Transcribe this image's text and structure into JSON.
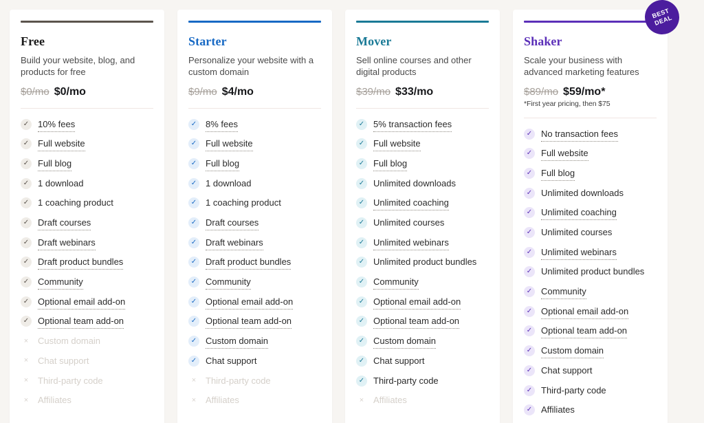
{
  "badge": {
    "line1": "BEST",
    "line2": "DEAL"
  },
  "plans": [
    {
      "id": "free",
      "name": "Free",
      "description": "Build your website, blog, and products for free",
      "price_old": "$0/mo",
      "price_now": "$0/mo",
      "price_note": "",
      "accent": "#5b544d",
      "features": [
        {
          "label": "10% fees",
          "included": true,
          "tooltip": true
        },
        {
          "label": "Full website",
          "included": true,
          "tooltip": true
        },
        {
          "label": "Full blog",
          "included": true,
          "tooltip": true
        },
        {
          "label": "1 download",
          "included": true,
          "tooltip": false
        },
        {
          "label": "1 coaching product",
          "included": true,
          "tooltip": false
        },
        {
          "label": "Draft courses",
          "included": true,
          "tooltip": true
        },
        {
          "label": "Draft webinars",
          "included": true,
          "tooltip": true
        },
        {
          "label": "Draft product bundles",
          "included": true,
          "tooltip": true
        },
        {
          "label": "Community",
          "included": true,
          "tooltip": true
        },
        {
          "label": "Optional email add-on",
          "included": true,
          "tooltip": true
        },
        {
          "label": "Optional team add-on",
          "included": true,
          "tooltip": true
        },
        {
          "label": "Custom domain",
          "included": false,
          "tooltip": false
        },
        {
          "label": "Chat support",
          "included": false,
          "tooltip": false
        },
        {
          "label": "Third-party code",
          "included": false,
          "tooltip": false
        },
        {
          "label": "Affiliates",
          "included": false,
          "tooltip": false
        }
      ]
    },
    {
      "id": "starter",
      "name": "Starter",
      "description": "Personalize your website with a custom domain",
      "price_old": "$9/mo",
      "price_now": "$4/mo",
      "price_note": "",
      "accent": "#1769c4",
      "features": [
        {
          "label": "8% fees",
          "included": true,
          "tooltip": true
        },
        {
          "label": "Full website",
          "included": true,
          "tooltip": true
        },
        {
          "label": "Full blog",
          "included": true,
          "tooltip": true
        },
        {
          "label": "1 download",
          "included": true,
          "tooltip": false
        },
        {
          "label": "1 coaching product",
          "included": true,
          "tooltip": false
        },
        {
          "label": "Draft courses",
          "included": true,
          "tooltip": true
        },
        {
          "label": "Draft webinars",
          "included": true,
          "tooltip": true
        },
        {
          "label": "Draft product bundles",
          "included": true,
          "tooltip": true
        },
        {
          "label": "Community",
          "included": true,
          "tooltip": true
        },
        {
          "label": "Optional email add-on",
          "included": true,
          "tooltip": true
        },
        {
          "label": "Optional team add-on",
          "included": true,
          "tooltip": true
        },
        {
          "label": "Custom domain",
          "included": true,
          "tooltip": true
        },
        {
          "label": "Chat support",
          "included": true,
          "tooltip": false
        },
        {
          "label": "Third-party code",
          "included": false,
          "tooltip": false
        },
        {
          "label": "Affiliates",
          "included": false,
          "tooltip": false
        }
      ]
    },
    {
      "id": "mover",
      "name": "Mover",
      "description": "Sell online courses and other digital products",
      "price_old": "$39/mo",
      "price_now": "$33/mo",
      "price_note": "",
      "accent": "#1a7a96",
      "features": [
        {
          "label": "5% transaction fees",
          "included": true,
          "tooltip": true
        },
        {
          "label": "Full website",
          "included": true,
          "tooltip": true
        },
        {
          "label": "Full blog",
          "included": true,
          "tooltip": true
        },
        {
          "label": "Unlimited downloads",
          "included": true,
          "tooltip": false
        },
        {
          "label": "Unlimited coaching",
          "included": true,
          "tooltip": true
        },
        {
          "label": "Unlimited courses",
          "included": true,
          "tooltip": false
        },
        {
          "label": "Unlimited webinars",
          "included": true,
          "tooltip": true
        },
        {
          "label": "Unlimited product bundles",
          "included": true,
          "tooltip": false
        },
        {
          "label": "Community",
          "included": true,
          "tooltip": true
        },
        {
          "label": "Optional email add-on",
          "included": true,
          "tooltip": true
        },
        {
          "label": "Optional team add-on",
          "included": true,
          "tooltip": true
        },
        {
          "label": "Custom domain",
          "included": true,
          "tooltip": true
        },
        {
          "label": "Chat support",
          "included": true,
          "tooltip": false
        },
        {
          "label": "Third-party code",
          "included": true,
          "tooltip": false
        },
        {
          "label": "Affiliates",
          "included": false,
          "tooltip": false
        }
      ]
    },
    {
      "id": "shaker",
      "name": "Shaker",
      "description": "Scale your business with advanced marketing features",
      "price_old": "$89/mo",
      "price_now": "$59/mo*",
      "price_note": "*First year pricing, then $75",
      "accent": "#5b2fb8",
      "features": [
        {
          "label": "No transaction fees",
          "included": true,
          "tooltip": true
        },
        {
          "label": "Full website",
          "included": true,
          "tooltip": true
        },
        {
          "label": "Full blog",
          "included": true,
          "tooltip": true
        },
        {
          "label": "Unlimited downloads",
          "included": true,
          "tooltip": false
        },
        {
          "label": "Unlimited coaching",
          "included": true,
          "tooltip": true
        },
        {
          "label": "Unlimited courses",
          "included": true,
          "tooltip": false
        },
        {
          "label": "Unlimited webinars",
          "included": true,
          "tooltip": true
        },
        {
          "label": "Unlimited product bundles",
          "included": true,
          "tooltip": false
        },
        {
          "label": "Community",
          "included": true,
          "tooltip": true
        },
        {
          "label": "Optional email add-on",
          "included": true,
          "tooltip": true
        },
        {
          "label": "Optional team add-on",
          "included": true,
          "tooltip": true
        },
        {
          "label": "Custom domain",
          "included": true,
          "tooltip": true
        },
        {
          "label": "Chat support",
          "included": true,
          "tooltip": false
        },
        {
          "label": "Third-party code",
          "included": true,
          "tooltip": false
        },
        {
          "label": "Affiliates",
          "included": true,
          "tooltip": false
        }
      ]
    }
  ],
  "icons": {
    "check": "✓",
    "cross": "×"
  }
}
